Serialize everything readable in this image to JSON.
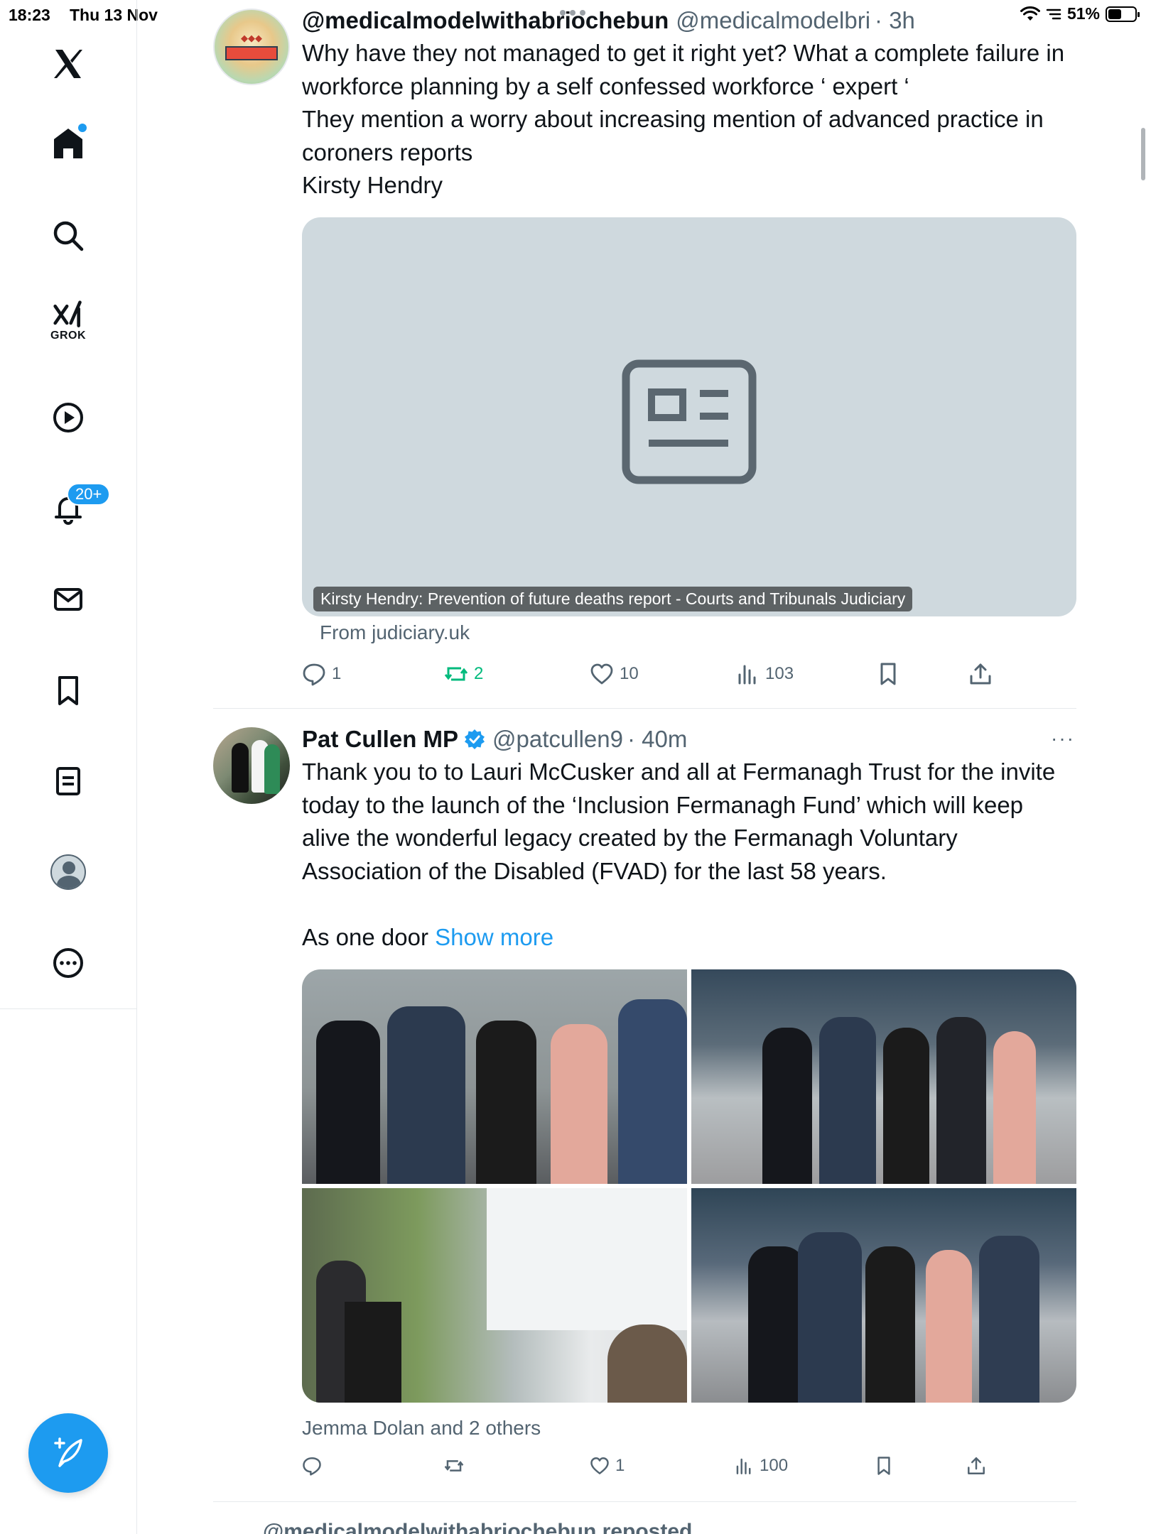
{
  "status_bar": {
    "time": "18:23",
    "date": "Thu 13 Nov",
    "battery": "51%",
    "battery_level": 0.51
  },
  "sidebar": {
    "grok_label": "GROK",
    "notifications_badge": "20+",
    "compose_icon": "feather-plus-icon"
  },
  "tweets": [
    {
      "author": "@medicalmodelwithabriochebun",
      "handle": "@medicalmodelbri",
      "time": "· 3h",
      "text": "Why have they not managed to get it right yet? What a complete failure in workforce planning by a self confessed workforce ‘ expert ‘\nThey mention a worry about increasing mention of advanced practice in coroners reports\nKirsty Hendry",
      "card": {
        "title": "Kirsty Hendry: Prevention of future deaths report - Courts and Tribunals Judiciary",
        "source": "From judiciary.uk"
      },
      "actions": {
        "replies": "1",
        "reposts": "2",
        "likes": "10",
        "views": "103"
      }
    },
    {
      "author": "Pat Cullen MP",
      "handle": "@patcullen9",
      "time": "· 40m",
      "text": "Thank you to to Lauri McCusker and all at Fermanagh Trust for the invite today to the launch of the ‘Inclusion Fermanagh Fund’ which will keep alive the wonderful legacy created by the Fermanagh Voluntary Association of the Disabled (FVAD) for the last 58 years.\n\nAs one door",
      "show_more": "Show more",
      "liked_by": "Jemma Dolan and 2 others",
      "actions": {
        "replies": "",
        "reposts": "",
        "likes": "1",
        "views": "100"
      }
    }
  ],
  "next_item": {
    "reposted_by": "@medicalmodelwithabriochebun reposted"
  },
  "colors": {
    "accent": "#1d9bf0",
    "repost_active": "#00ba7c",
    "muted_text": "#536471"
  }
}
